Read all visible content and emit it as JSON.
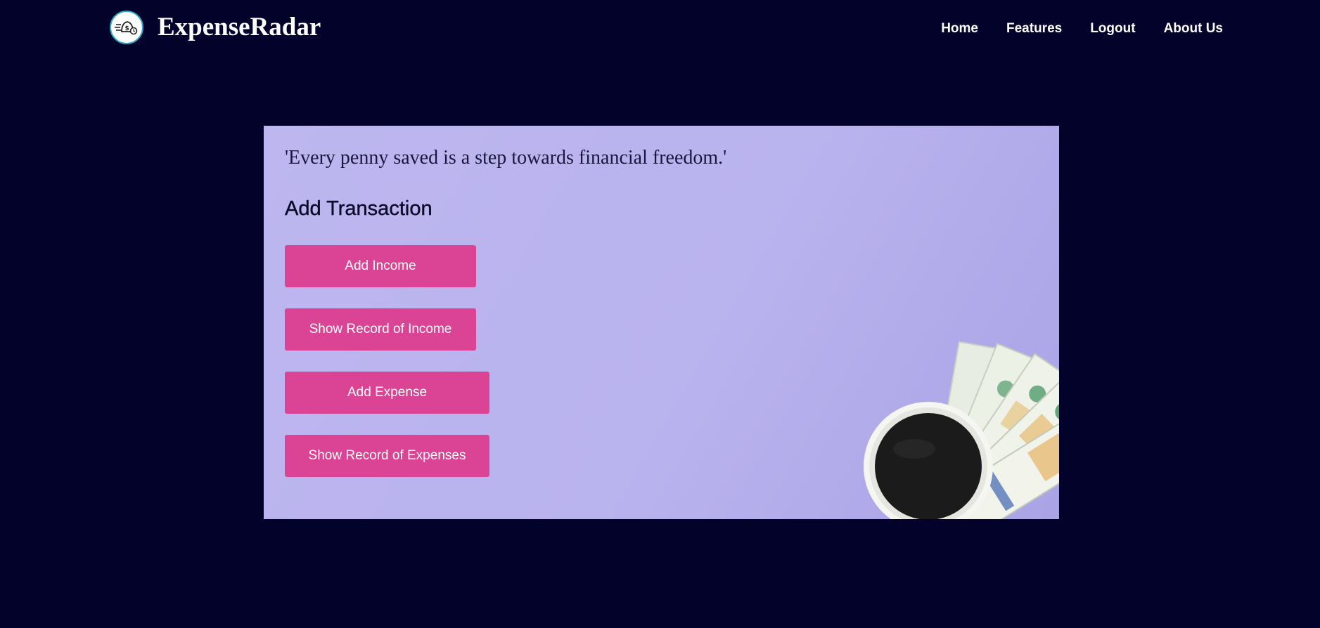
{
  "header": {
    "logo_icon": "money-radar-icon",
    "brand": "ExpenseRadar",
    "nav": [
      {
        "label": "Home"
      },
      {
        "label": "Features"
      },
      {
        "label": "Logout"
      },
      {
        "label": "About Us"
      }
    ]
  },
  "hero": {
    "quote": "'Every penny saved is a step towards financial freedom.'",
    "title": "Add Transaction",
    "buttons": {
      "add_income": "Add Income",
      "show_income": "Show Record of Income",
      "add_expense": "Add Expense",
      "show_expenses": "Show Record of Expenses"
    },
    "image_icon": "money-and-coffee-image"
  },
  "colors": {
    "background": "#02022a",
    "hero_bg": "#bdb6ef",
    "button": "#db4494",
    "logo_border": "#2fa4c4"
  }
}
